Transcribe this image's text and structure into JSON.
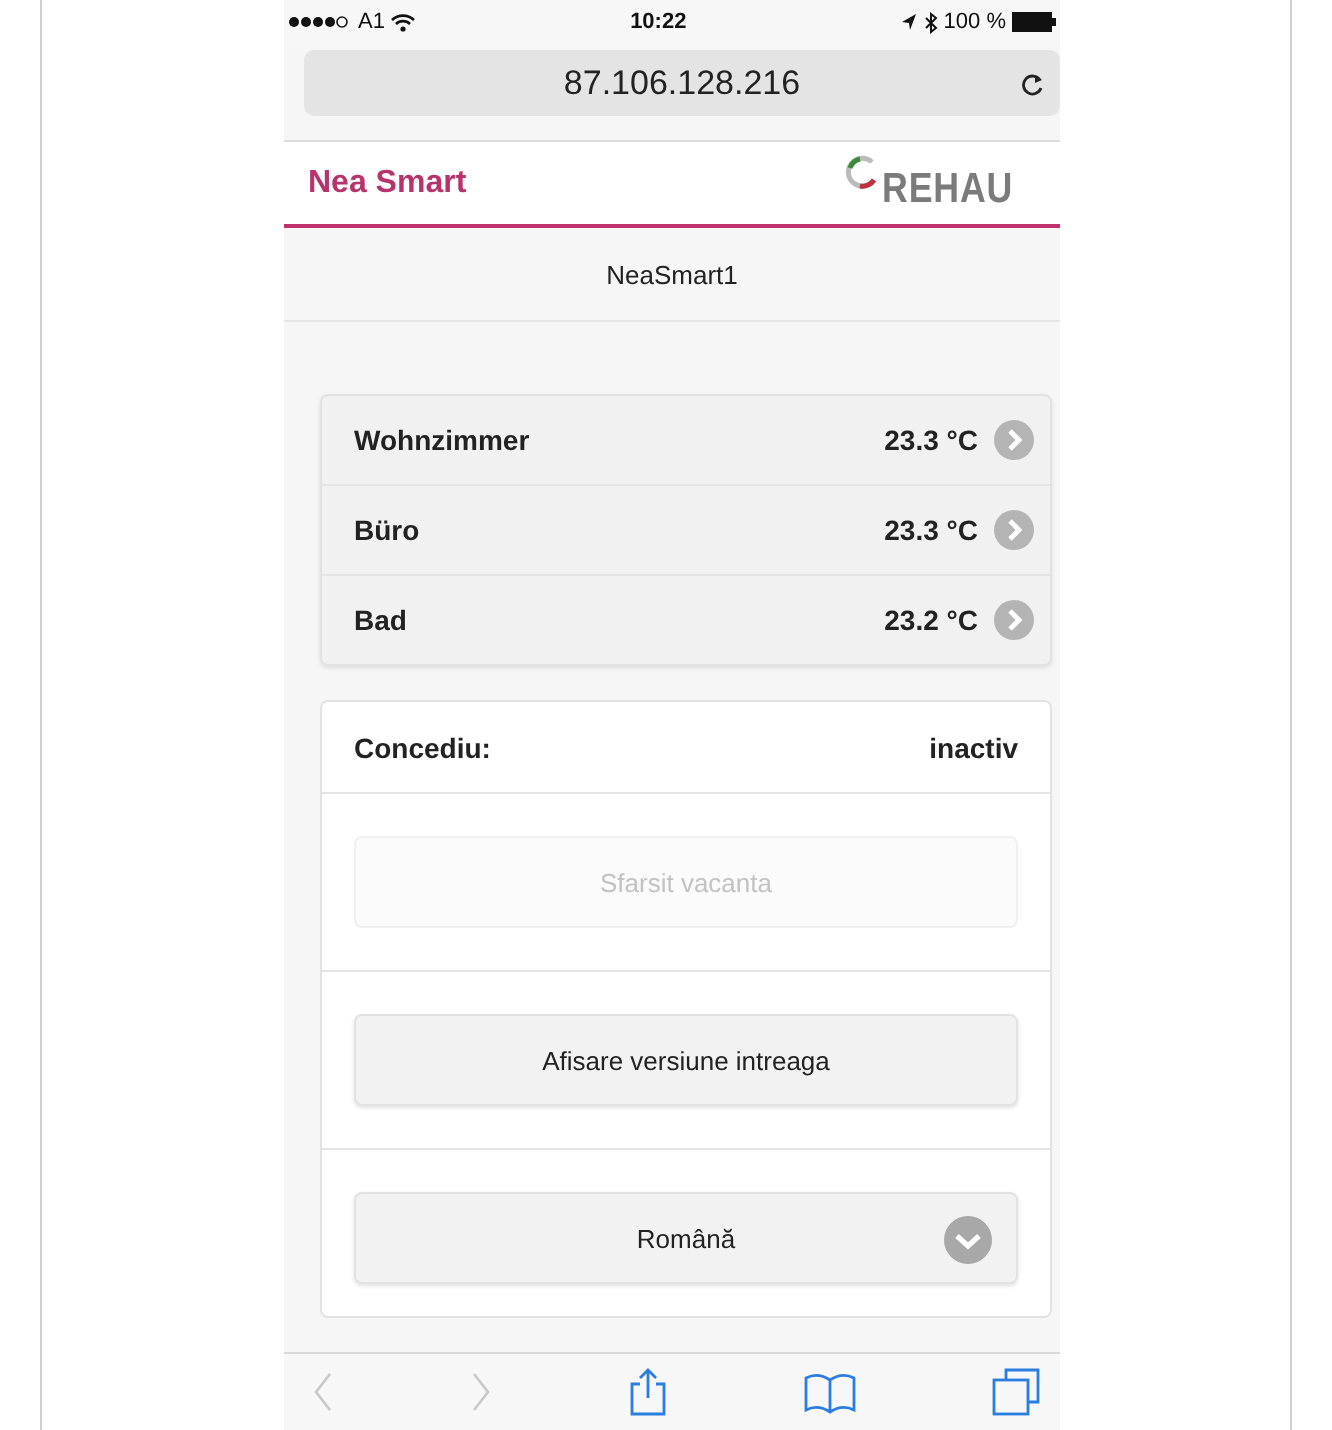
{
  "status_bar": {
    "carrier": "A1",
    "time": "10:22",
    "battery": "100 %"
  },
  "address_bar": {
    "url": "87.106.128.216"
  },
  "header": {
    "title": "Nea Smart",
    "logo": "REHAU"
  },
  "device": "NeaSmart1",
  "rooms": [
    {
      "name": "Wohnzimmer",
      "temperature": "23.3 °C"
    },
    {
      "name": "Büro",
      "temperature": "23.3 °C"
    },
    {
      "name": "Bad",
      "temperature": "23.2 °C"
    }
  ],
  "vacation": {
    "label": "Concediu:",
    "status": "inactiv",
    "end_button": {
      "label": "Sfarsit vacanta",
      "disabled": true
    }
  },
  "full_version_button": {
    "label": "Afisare versiune intreaga",
    "disabled": false
  },
  "language_select": {
    "value": "Română"
  },
  "toolbar": [
    {
      "kind": "back",
      "disabled": true
    },
    {
      "kind": "forward",
      "disabled": true
    },
    {
      "kind": "share",
      "disabled": false
    },
    {
      "kind": "bookmarks",
      "disabled": false
    },
    {
      "kind": "tabs",
      "disabled": false
    }
  ]
}
